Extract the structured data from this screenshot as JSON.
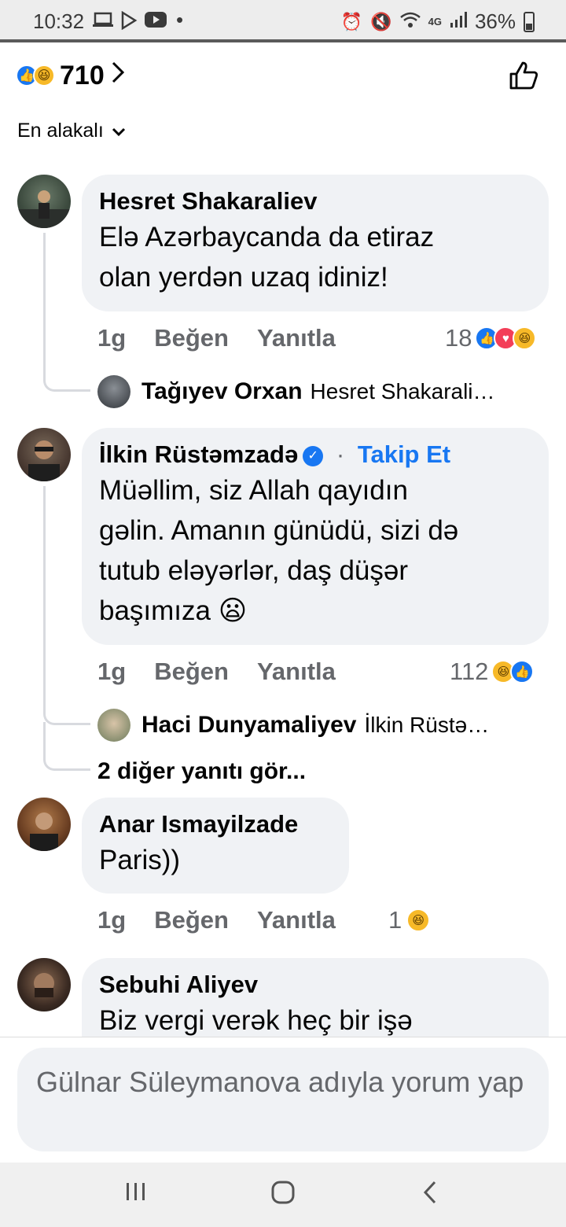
{
  "status_bar": {
    "time": "10:32",
    "battery": "36%",
    "network": "4G"
  },
  "header": {
    "reaction_count": "710",
    "sort_label": "En alakalı"
  },
  "comments": [
    {
      "author": "Hesret Shakaraliev",
      "lines": [
        "Elə Azərbaycanda da etiraz",
        "olan yerdən uzaq idiniz!"
      ],
      "time": "1g",
      "like": "Beğen",
      "reply": "Yanıtla",
      "reaction_count": "18",
      "replies": [
        {
          "author": "Tağıyev Orxan",
          "text": "Hesret Shakarali…"
        }
      ]
    },
    {
      "author": "İlkin Rüstəmzadə",
      "follow": "Takip Et",
      "follow_sep": "·",
      "lines": [
        "Müəllim, siz Allah qayıdın",
        "gəlin. Amanın günüdü, sizi də",
        "tutub eləyərlər, daş düşər",
        "başımıza 😦"
      ],
      "time": "1g",
      "like": "Beğen",
      "reply": "Yanıtla",
      "reaction_count": "112",
      "replies": [
        {
          "author": "Haci Dunyamaliyev",
          "text": "İlkin Rüstə…"
        }
      ],
      "more_replies": "2 diğer yanıtı gör..."
    },
    {
      "author": "Anar Ismayilzade",
      "lines": [
        "Paris))"
      ],
      "time": "1g",
      "like": "Beğen",
      "reply": "Yanıtla",
      "reaction_count": "1"
    },
    {
      "author": "Sebuhi Aliyev",
      "lines": [
        "Biz vergi verək heç bir işə"
      ]
    }
  ],
  "composer": {
    "placeholder": "Gülnar Süleymanova adıyla yorum yap"
  },
  "nav": {
    "recents": "|||",
    "home": "○",
    "back": "<"
  },
  "colors": {
    "accent": "#1877f2",
    "bubble": "#f0f2f5",
    "meta_text": "#65676b"
  }
}
